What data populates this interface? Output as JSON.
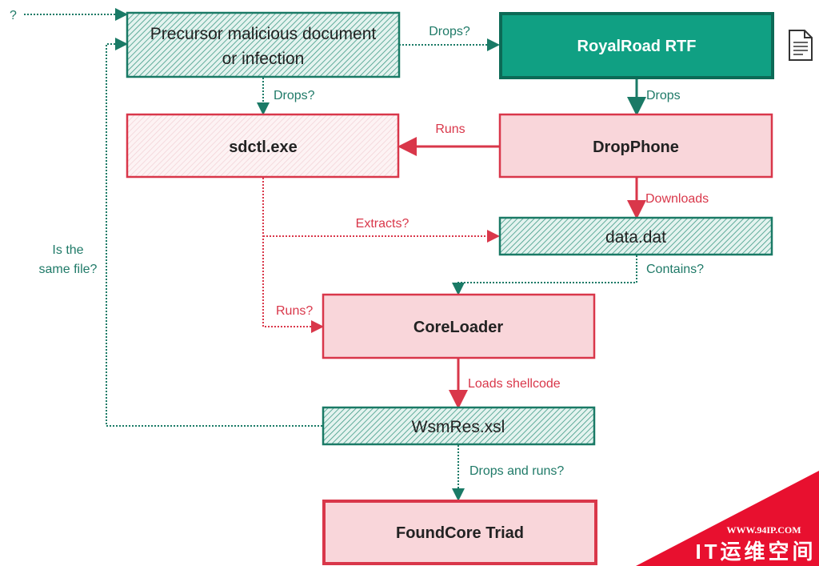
{
  "colors": {
    "teal": "#1a7a66",
    "teal_fill": "#10a083",
    "red": "#d9374a",
    "pink": "#f9d6da"
  },
  "nodes": {
    "precursor": {
      "line1": "Precursor malicious document",
      "line2": "or infection"
    },
    "royalroad": "RoyalRoad RTF",
    "sdctl": "sdctl.exe",
    "dropphone": "DropPhone",
    "datadat": "data.dat",
    "coreloader": "CoreLoader",
    "wsmres": "WsmRes.xsl",
    "foundcore": "FoundCore Triad"
  },
  "edges": {
    "unknown_source": "?",
    "same_file": {
      "line1": "Is the",
      "line2": "same file?"
    },
    "precursor_to_royalroad": "Drops?",
    "precursor_to_sdctl": "Drops?",
    "royalroad_to_dropphone": "Drops",
    "dropphone_to_sdctl": "Runs",
    "dropphone_to_datadat": "Downloads",
    "sdctl_to_datadat": "Extracts?",
    "sdctl_to_coreloader": "Runs?",
    "datadat_to_coreloader": "Contains?",
    "coreloader_to_wsmres": "Loads shellcode",
    "wsmres_to_foundcore": "Drops and runs?"
  },
  "icons": {
    "document": "document-icon"
  },
  "watermark": {
    "url": "WWW.94IP.COM",
    "name": "IT运维空间"
  }
}
